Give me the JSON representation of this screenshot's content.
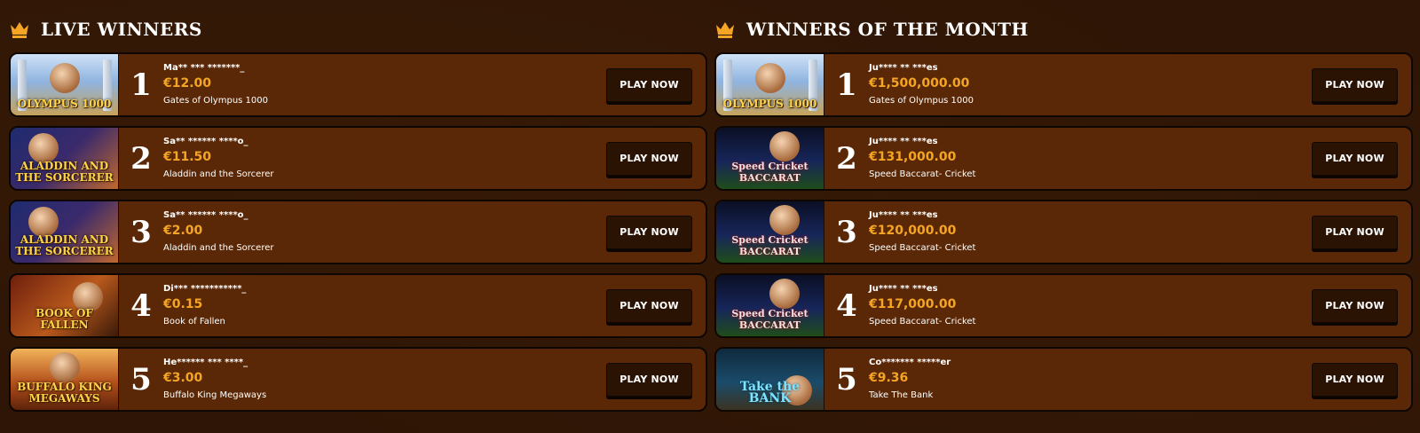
{
  "sections": [
    {
      "title": "LIVE WINNERS",
      "rows": [
        {
          "rank": "1",
          "player": "Ma** *** *******_",
          "amount": "€12.00",
          "game": "Gates of Olympus 1000",
          "thumb": "olympus",
          "thumb_label": "OLYMPUS 1000"
        },
        {
          "rank": "2",
          "player": "Sa** ****** ****o_",
          "amount": "€11.50",
          "game": "Aladdin and the Sorcerer",
          "thumb": "aladdin",
          "thumb_label": "ALADDIN AND THE SORCERER"
        },
        {
          "rank": "3",
          "player": "Sa** ****** ****o_",
          "amount": "€2.00",
          "game": "Aladdin and the Sorcerer",
          "thumb": "aladdin",
          "thumb_label": "ALADDIN AND THE SORCERER"
        },
        {
          "rank": "4",
          "player": "Di*** ***********_",
          "amount": "€0.15",
          "game": "Book of Fallen",
          "thumb": "fallen",
          "thumb_label": "BOOK OF FALLEN"
        },
        {
          "rank": "5",
          "player": "He****** *** ****_",
          "amount": "€3.00",
          "game": "Buffalo King Megaways",
          "thumb": "buffalo",
          "thumb_label": "BUFFALO KING MEGAWAYS"
        }
      ]
    },
    {
      "title": "WINNERS OF THE MONTH",
      "rows": [
        {
          "rank": "1",
          "player": "Ju**** ** ***es",
          "amount": "€1,500,000.00",
          "game": "Gates of Olympus 1000",
          "thumb": "olympus",
          "thumb_label": "OLYMPUS 1000"
        },
        {
          "rank": "2",
          "player": "Ju**** ** ***es",
          "amount": "€131,000.00",
          "game": "Speed Baccarat- Cricket",
          "thumb": "baccarat",
          "thumb_label": "Speed Cricket BACCARAT"
        },
        {
          "rank": "3",
          "player": "Ju**** ** ***es",
          "amount": "€120,000.00",
          "game": "Speed Baccarat- Cricket",
          "thumb": "baccarat",
          "thumb_label": "Speed Cricket BACCARAT"
        },
        {
          "rank": "4",
          "player": "Ju**** ** ***es",
          "amount": "€117,000.00",
          "game": "Speed Baccarat- Cricket",
          "thumb": "baccarat",
          "thumb_label": "Speed Cricket BACCARAT"
        },
        {
          "rank": "5",
          "player": "Co******* *****er",
          "amount": "€9.36",
          "game": "Take The Bank",
          "thumb": "bank",
          "thumb_label": "Take the BANK"
        }
      ]
    }
  ],
  "play_button_label": "PLAY NOW",
  "colors": {
    "background": "#2e1505",
    "row": "#5a2806",
    "amount": "#f5a524",
    "crown": "#f5a524",
    "button": "#2b1304"
  },
  "icons": {
    "section": "crown-icon"
  }
}
